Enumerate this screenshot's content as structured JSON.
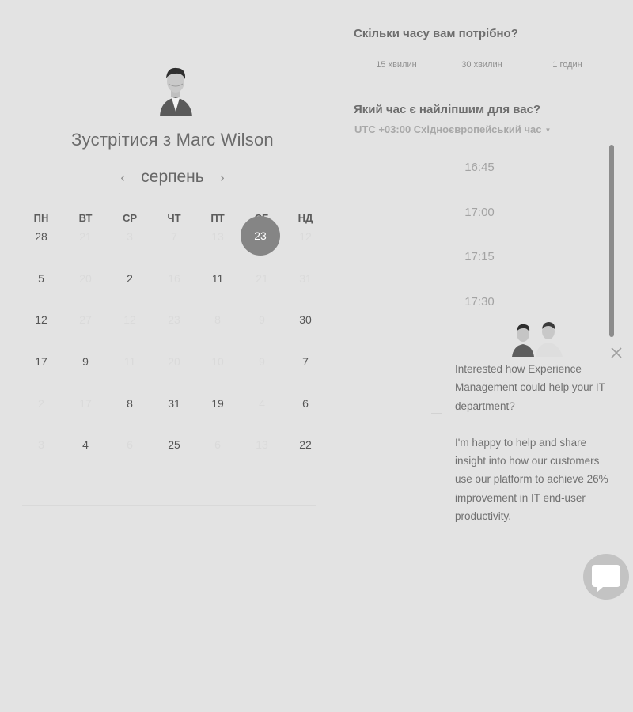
{
  "scheduler": {
    "title_prefix": "Зустрітися з",
    "host_name": "Marc Wilson",
    "month": "серпень",
    "prev_arrow": "‹",
    "next_arrow": "›",
    "weekdays": [
      "ПН",
      "ВТ",
      "СР",
      "ЧТ",
      "ПТ",
      "СБ",
      "НД"
    ],
    "weeks": [
      [
        {
          "d": "28",
          "on": true
        },
        {
          "d": "21",
          "on": false
        },
        {
          "d": "3",
          "on": false
        },
        {
          "d": "7",
          "on": false
        },
        {
          "d": "13",
          "on": false
        },
        {
          "d": "23",
          "on": true,
          "selected": true
        },
        {
          "d": "12",
          "on": false
        }
      ],
      [
        {
          "d": "5",
          "on": true
        },
        {
          "d": "20",
          "on": false
        },
        {
          "d": "2",
          "on": true
        },
        {
          "d": "16",
          "on": false
        },
        {
          "d": "11",
          "on": true
        },
        {
          "d": "21",
          "on": false
        },
        {
          "d": "31",
          "on": false
        }
      ],
      [
        {
          "d": "12",
          "on": true
        },
        {
          "d": "27",
          "on": false
        },
        {
          "d": "12",
          "on": false
        },
        {
          "d": "23",
          "on": false
        },
        {
          "d": "8",
          "on": false
        },
        {
          "d": "9",
          "on": false
        },
        {
          "d": "30",
          "on": true
        }
      ],
      [
        {
          "d": "17",
          "on": true
        },
        {
          "d": "9",
          "on": true
        },
        {
          "d": "11",
          "on": false
        },
        {
          "d": "20",
          "on": false
        },
        {
          "d": "10",
          "on": false
        },
        {
          "d": "9",
          "on": false
        },
        {
          "d": "7",
          "on": true
        }
      ],
      [
        {
          "d": "2",
          "on": false
        },
        {
          "d": "17",
          "on": false
        },
        {
          "d": "8",
          "on": true
        },
        {
          "d": "31",
          "on": true
        },
        {
          "d": "19",
          "on": true
        },
        {
          "d": "4",
          "on": false
        },
        {
          "d": "6",
          "on": true
        }
      ],
      [
        {
          "d": "3",
          "on": false
        },
        {
          "d": "4",
          "on": true
        },
        {
          "d": "6",
          "on": false
        },
        {
          "d": "25",
          "on": true
        },
        {
          "d": "6",
          "on": false
        },
        {
          "d": "13",
          "on": false
        },
        {
          "d": "22",
          "on": true
        }
      ]
    ]
  },
  "duration": {
    "question": "Скільки часу вам потрібно?",
    "options": [
      "15 хвилин",
      "30 хвилин",
      "1 годин"
    ]
  },
  "time": {
    "question": "Який час є найліпшим для вас?",
    "timezone": "UTC +03:00 Східноєвропейський час",
    "slots": [
      "16:45",
      "17:00",
      "17:15",
      "17:30"
    ]
  },
  "chat": {
    "message_1": "Interested how Experience Management could help your IT department?",
    "message_2": "I'm happy to help and share insight into how our customers use our platform to achieve 26% improvement in IT end-user productivity."
  },
  "colors": {
    "background": "#e3e3e3",
    "selected_day": "#858585",
    "scrollbar": "#8c8c8c",
    "chat_button": "#c3c3c3"
  }
}
